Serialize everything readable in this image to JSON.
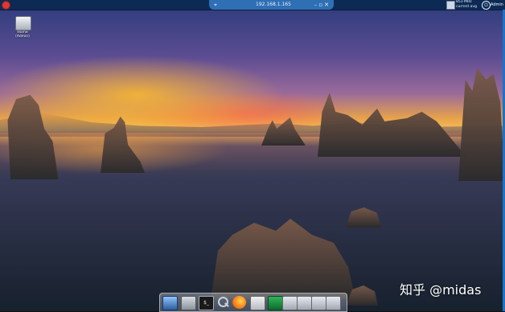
{
  "top_bar": {
    "remote_host": "192.168.1.165",
    "tray": {
      "memory_line1": "853 MHz",
      "memory_line2": "current avg",
      "user": "Admin"
    }
  },
  "desktop": {
    "icon_label": "Home (Admin)"
  },
  "watermark": "知乎 @midas",
  "icons": {
    "close": "close-icon",
    "pin": "pin-icon",
    "minimize": "minimize-icon",
    "restore": "restore-icon",
    "window_close": "close-icon",
    "power": "power-icon"
  },
  "colors": {
    "topbar": "#0c2a54",
    "remote_tab": "#2f6fb4",
    "close_red": "#d83a3a"
  }
}
